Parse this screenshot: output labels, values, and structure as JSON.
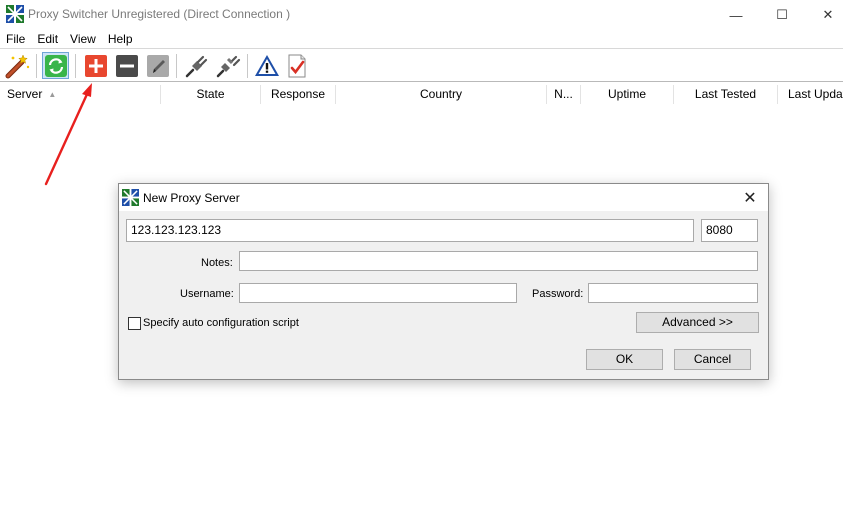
{
  "window": {
    "title": "Proxy Switcher Unregistered (Direct Connection )",
    "minimize": "—",
    "maximize": "☐",
    "close": "✕"
  },
  "menu": [
    "File",
    "Edit",
    "View",
    "Help"
  ],
  "toolbar": {
    "buttons": [
      {
        "name": "wizard-icon"
      },
      {
        "name": "refresh-icon",
        "active": true
      },
      {
        "name": "add-server-icon",
        "color": "#e8472f"
      },
      {
        "name": "remove-server-icon",
        "color": "#4a4a4a"
      },
      {
        "name": "edit-pencil-icon"
      },
      {
        "name": "connect-plug-icon"
      },
      {
        "name": "disconnect-plug-icon"
      },
      {
        "name": "warning-icon",
        "color": "#1e4fa8"
      },
      {
        "name": "checklist-icon",
        "color": "#d93025"
      }
    ]
  },
  "list": {
    "columns": [
      "Server",
      "State",
      "Response",
      "Country",
      "N...",
      "Uptime",
      "Last Tested",
      "Last Updat"
    ],
    "sort_indicator": "▲"
  },
  "dialog": {
    "title": "New Proxy Server",
    "close": "✕",
    "address": "123.123.123.123",
    "port": "8080",
    "notes_label": "Notes:",
    "notes_value": "",
    "username_label": "Username:",
    "username_value": "",
    "password_label": "Password:",
    "password_value": "",
    "auto_config_label": "Specify auto configuration script",
    "advanced_label": "Advanced >>",
    "ok_label": "OK",
    "cancel_label": "Cancel"
  },
  "annotation_color": "#e8201e"
}
